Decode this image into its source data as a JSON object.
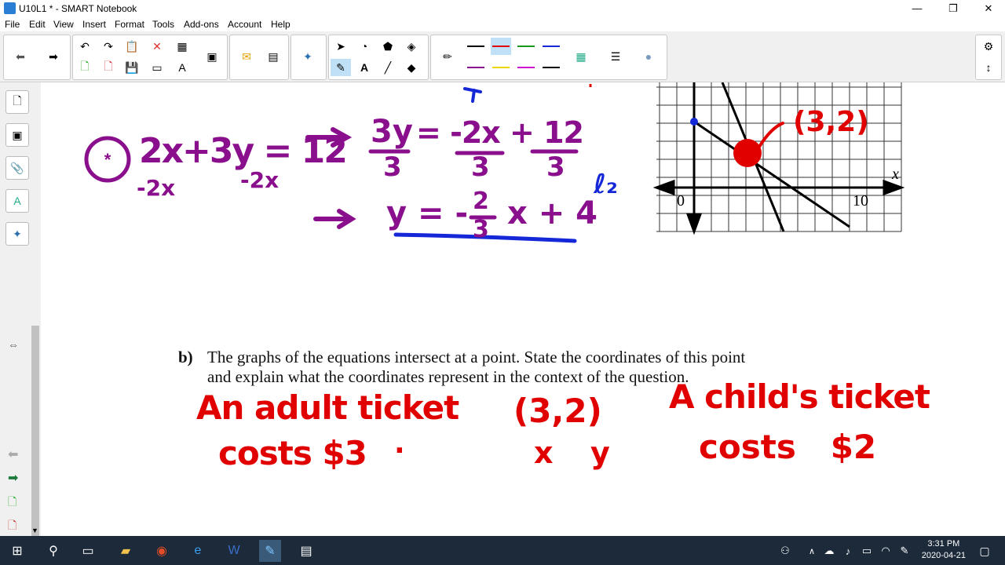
{
  "window": {
    "title": "U10L1 * - SMART Notebook",
    "minimize": "—",
    "maximize": "❐",
    "close": "✕"
  },
  "menu": [
    "File",
    "Edit",
    "View",
    "Insert",
    "Format",
    "Tools",
    "Add-ons",
    "Account",
    "Help"
  ],
  "colors": {
    "purple": "#8a0f8c",
    "red": "#e10000",
    "blue": "#1428d8",
    "black": "#111111"
  },
  "printed_text": {
    "part_label": "b)",
    "line1": "The graphs of the equations intersect at a point.  State the coordinates of this point",
    "line2": "and explain what the coordinates represent in the context of the question."
  },
  "graph": {
    "origin_label": "0",
    "x_tick_label": "10",
    "x_axis_label": "x"
  },
  "ink": {
    "eq_left": "2x+3y = 12",
    "eq_sub_left": "-2x",
    "eq_sub_right": "-2x",
    "step_num_left": "3y",
    "step_den_left": "3",
    "step_eq": "= -2x + 12",
    "step_den_mid": "3",
    "step_den_right": "3",
    "slope_form_left": "y = -",
    "slope_num": "2",
    "slope_den": "3",
    "slope_form_right": "x + 4",
    "line_tag": "ℓ₂",
    "point_label": "(3,2)",
    "adult_line1": "An adult ticket",
    "adult_line2": "costs $3",
    "adult_dot": ".",
    "coord": "(3,2)",
    "coord_x": "x",
    "coord_y": "y",
    "child_line1": "A child's ticket",
    "child_line2": "costs   $2"
  },
  "taskbar": {
    "time": "3:31 PM",
    "date": "2020-04-21"
  }
}
